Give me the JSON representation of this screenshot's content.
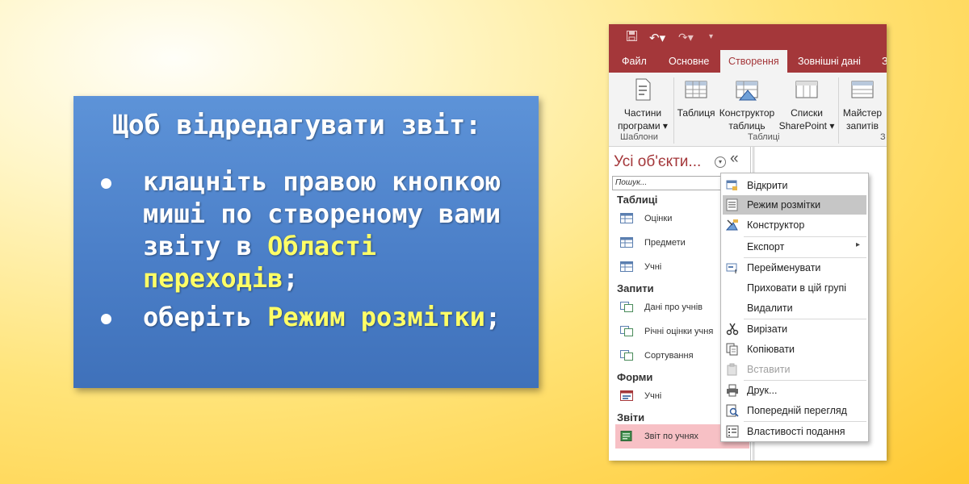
{
  "card": {
    "title": "Щоб відредагувати звіт:",
    "bullet1_a": "клацніть правою кнопкою миші по створеному вами звіту в ",
    "bullet1_hl": "Області переходів",
    "bullet1_b": ";",
    "bullet2_a": "оберіть ",
    "bullet2_hl": "Режим розмітки",
    "bullet2_b": ";"
  },
  "ribbon": {
    "tabs": [
      "Файл",
      "Основне",
      "Створення",
      "Зовнішні дані",
      "З"
    ],
    "active_tab": "Створення",
    "buttons": [
      {
        "label1": "Частини",
        "label2": "програми ▾"
      },
      {
        "label1": "Таблиця",
        "label2": ""
      },
      {
        "label1": "Конструктор",
        "label2": "таблиць"
      },
      {
        "label1": "Списки",
        "label2": "SharePoint ▾"
      },
      {
        "label1": "Майстер",
        "label2": "запитів"
      }
    ],
    "groups": [
      "Шаблони",
      "Таблиці",
      "З"
    ]
  },
  "nav": {
    "header": "Усі об'єкти...",
    "collapse": "«",
    "search_placeholder": "Пошук...",
    "groups": {
      "tables": "Таблиці",
      "queries": "Запити",
      "forms": "Форми",
      "reports": "Звіти"
    },
    "tables": [
      "Оцінки",
      "Предмети",
      "Учні"
    ],
    "queries": [
      "Дані про учнів",
      "Річні оцінки учня",
      "Сортування"
    ],
    "forms": [
      "Учні"
    ],
    "reports": [
      "Звіт по учнях"
    ]
  },
  "menu": {
    "items": [
      {
        "label": "Відкрити"
      },
      {
        "label": "Режим розмітки"
      },
      {
        "label": "Конструктор"
      },
      {
        "label": "Експорт"
      },
      {
        "label": "Перейменувати"
      },
      {
        "label": "Приховати в цій групі"
      },
      {
        "label": "Видалити"
      },
      {
        "label": "Вирізати"
      },
      {
        "label": "Копіювати"
      },
      {
        "label": "Вставити"
      },
      {
        "label": "Друк..."
      },
      {
        "label": "Попередній перегляд"
      },
      {
        "label": "Властивості подання"
      }
    ]
  },
  "colors": {
    "access_red": "#a4373a",
    "card_blue": "#4b7fc8",
    "highlight_yellow": "#ffff66",
    "selected_pink": "#f7c0c5"
  }
}
